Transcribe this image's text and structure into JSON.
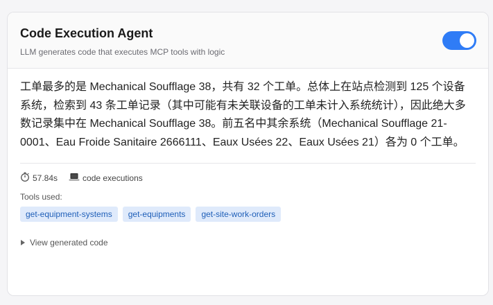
{
  "header": {
    "title": "Code Execution Agent",
    "subtitle": "LLM generates code that executes MCP tools with logic",
    "toggle_on": true
  },
  "answer": {
    "text": "工单最多的是 Mechanical Soufflage 38，共有 32 个工单。总体上在站点检测到 125 个设备系统，检索到 43 条工单记录（其中可能有未关联设备的工单未计入系统统计），因此绝大多数记录集中在 Mechanical Soufflage 38。前五名中其余系统（Mechanical Soufflage 21-0001、Eau Froide Sanitaire 2666111、Eaux Usées 22、Eaux Usées 21）各为 0 个工单。"
  },
  "meta": {
    "duration": "57.84s",
    "duration_icon": "stopwatch-icon",
    "executions": "code executions",
    "executions_icon": "laptop-icon"
  },
  "tools": {
    "label": "Tools used:",
    "items": [
      "get-equipment-systems",
      "get-equipments",
      "get-site-work-orders"
    ]
  },
  "details": {
    "label": "View generated code",
    "icon": "disclosure-triangle-icon"
  },
  "colors": {
    "accent": "#2f7cf6",
    "chip_bg": "#dfeafb",
    "chip_text": "#1f5fb8"
  }
}
